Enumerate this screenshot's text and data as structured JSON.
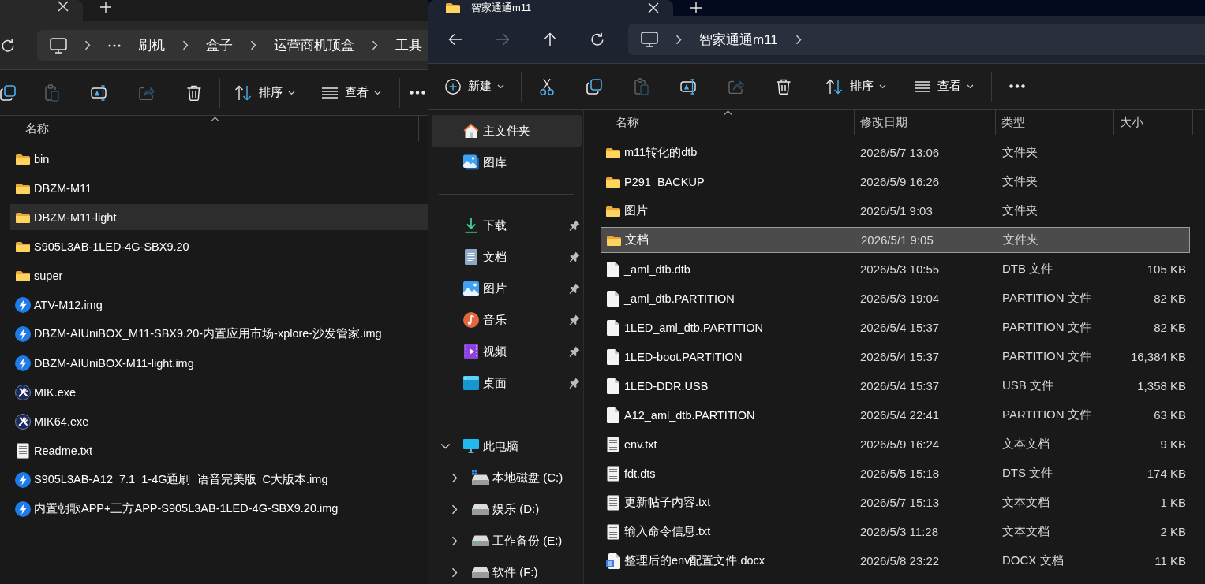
{
  "left_window": {
    "active": false,
    "tabs": [
      {
        "selected": true
      }
    ],
    "address_bar": {
      "overflow": true,
      "path": [
        "刷机",
        "盒子",
        "运营商机顶盒",
        "工具"
      ]
    },
    "toolbar": {
      "actions": [
        {
          "disabled": false
        },
        {
          "disabled": true
        },
        {
          "disabled": false
        },
        {
          "disabled": true
        },
        {
          "disabled": false
        }
      ],
      "sort": {
        "label": "排序"
      },
      "view": {
        "label": "查看"
      }
    },
    "file_list": {
      "columns": [
        {
          "label": "名称",
          "sorted": true
        }
      ],
      "rows": [
        {
          "kind": "folder",
          "name": "bin",
          "selected": false
        },
        {
          "kind": "folder",
          "name": "DBZM-M11",
          "selected": false
        },
        {
          "kind": "folder",
          "name": "DBZM-M11-light",
          "selected": true
        },
        {
          "kind": "folder",
          "name": "S905L3AB-1LED-4G-SBX9.20",
          "selected": false
        },
        {
          "kind": "folder",
          "name": "super",
          "selected": false
        },
        {
          "kind": "image",
          "name": "ATV-M12.img",
          "selected": false
        },
        {
          "kind": "image",
          "name": "DBZM-AIUniBOX_M11-SBX9.20-内置应用市场-xplore-沙发管家.img",
          "selected": false
        },
        {
          "kind": "image",
          "name": "DBZM-AIUniBOX-M11-light.img",
          "selected": false
        },
        {
          "kind": "app",
          "name": "MIK.exe",
          "selected": false
        },
        {
          "kind": "app",
          "name": "MIK64.exe",
          "selected": false
        },
        {
          "kind": "text",
          "name": "Readme.txt",
          "selected": false
        },
        {
          "kind": "image",
          "name": "S905L3AB-A12_7.1_1-4G通刷_语音完美版_C大版本.img",
          "selected": false
        },
        {
          "kind": "image",
          "name": "内置朝歌APP+三方APP-S905L3AB-1LED-4G-SBX9.20.img",
          "selected": false
        }
      ]
    }
  },
  "right_window": {
    "active": true,
    "tabs": [
      {
        "title": "智家通通m11",
        "selected": true
      }
    ],
    "nav_buttons": [
      {
        "disabled": false
      },
      {
        "disabled": true
      },
      {
        "disabled": false
      },
      {
        "disabled": false
      }
    ],
    "address_bar": {
      "path": [
        "智家通通m11"
      ]
    },
    "toolbar": {
      "new": {
        "label": "新建"
      },
      "actions": [
        {
          "disabled": false
        },
        {
          "disabled": false
        },
        {
          "disabled": true
        },
        {
          "disabled": false
        },
        {
          "disabled": true
        },
        {
          "disabled": false
        }
      ],
      "sort": {
        "label": "排序"
      },
      "view": {
        "label": "查看"
      }
    },
    "navigation_pane": {
      "groups": [
        {
          "items": [
            {
              "kind": "home",
              "label": "主文件夹",
              "selected": true
            },
            {
              "kind": "gallery",
              "label": "图库",
              "selected": false
            }
          ]
        },
        {
          "items": [
            {
              "kind": "downloads",
              "label": "下载",
              "pinned": true,
              "selected": false
            },
            {
              "kind": "documents",
              "label": "文档",
              "pinned": true,
              "selected": false
            },
            {
              "kind": "pictures",
              "label": "图片",
              "pinned": true,
              "selected": false
            },
            {
              "kind": "music",
              "label": "音乐",
              "pinned": true,
              "selected": false
            },
            {
              "kind": "videos",
              "label": "视频",
              "pinned": true,
              "selected": false
            },
            {
              "kind": "desktop",
              "label": "桌面",
              "pinned": true,
              "selected": false
            }
          ]
        },
        {
          "items": [
            {
              "kind": "computer",
              "label": "此电脑",
              "expanded": true,
              "selected": false,
              "children": [
                {
                  "kind": "system-drive",
                  "label": "本地磁盘 (C:)",
                  "expanded": false,
                  "selected": false
                },
                {
                  "kind": "drive",
                  "label": "娱乐 (D:)",
                  "expanded": false,
                  "selected": false
                },
                {
                  "kind": "drive",
                  "label": "工作备份 (E:)",
                  "expanded": false,
                  "selected": false
                },
                {
                  "kind": "drive",
                  "label": "软件 (F:)",
                  "expanded": false,
                  "selected": false
                }
              ]
            }
          ]
        }
      ]
    },
    "file_list": {
      "columns": [
        {
          "label": "名称",
          "sorted": true
        },
        {
          "label": "修改日期",
          "sorted": false
        },
        {
          "label": "类型",
          "sorted": false
        },
        {
          "label": "大小",
          "sorted": false
        }
      ],
      "rows": [
        {
          "kind": "folder",
          "name": "m11转化的dtb",
          "modified": "2026/5/7 13:06",
          "type": "文件夹",
          "selected": false
        },
        {
          "kind": "folder",
          "name": "P291_BACKUP",
          "modified": "2026/5/9 16:26",
          "type": "文件夹",
          "selected": false
        },
        {
          "kind": "folder",
          "name": "图片",
          "modified": "2026/5/1 9:03",
          "type": "文件夹",
          "selected": false
        },
        {
          "kind": "folder",
          "name": "文档",
          "modified": "2026/5/1 9:05",
          "type": "文件夹",
          "selected": true
        },
        {
          "kind": "file",
          "name": "_aml_dtb.dtb",
          "modified": "2026/5/3 10:55",
          "type": "DTB 文件",
          "size": "105 KB",
          "selected": false
        },
        {
          "kind": "file",
          "name": "_aml_dtb.PARTITION",
          "modified": "2026/5/3 19:04",
          "type": "PARTITION 文件",
          "size": "82 KB",
          "selected": false
        },
        {
          "kind": "file",
          "name": "1LED_aml_dtb.PARTITION",
          "modified": "2026/5/4 15:37",
          "type": "PARTITION 文件",
          "size": "82 KB",
          "selected": false
        },
        {
          "kind": "file",
          "name": "1LED-boot.PARTITION",
          "modified": "2026/5/4 15:37",
          "type": "PARTITION 文件",
          "size": "16,384 KB",
          "selected": false
        },
        {
          "kind": "file",
          "name": "1LED-DDR.USB",
          "modified": "2026/5/4 15:37",
          "type": "USB 文件",
          "size": "1,358 KB",
          "selected": false
        },
        {
          "kind": "file",
          "name": "A12_aml_dtb.PARTITION",
          "modified": "2026/5/4 22:41",
          "type": "PARTITION 文件",
          "size": "63 KB",
          "selected": false
        },
        {
          "kind": "text",
          "name": "env.txt",
          "modified": "2026/5/9 16:24",
          "type": "文本文档",
          "size": "9 KB",
          "selected": false
        },
        {
          "kind": "text",
          "name": "fdt.dts",
          "modified": "2026/5/5 15:18",
          "type": "DTS 文件",
          "size": "174 KB",
          "selected": false
        },
        {
          "kind": "text",
          "name": "更新帖子内容.txt",
          "modified": "2026/5/7 15:13",
          "type": "文本文档",
          "size": "1 KB",
          "selected": false
        },
        {
          "kind": "text",
          "name": "输入命令信息.txt",
          "modified": "2026/5/3 11:28",
          "type": "文本文档",
          "size": "2 KB",
          "selected": false
        },
        {
          "kind": "docx",
          "name": "整理后的env配置文件.docx",
          "modified": "2026/5/8 23:22",
          "type": "DOCX 文档",
          "size": "11 KB",
          "selected": false
        }
      ]
    }
  }
}
